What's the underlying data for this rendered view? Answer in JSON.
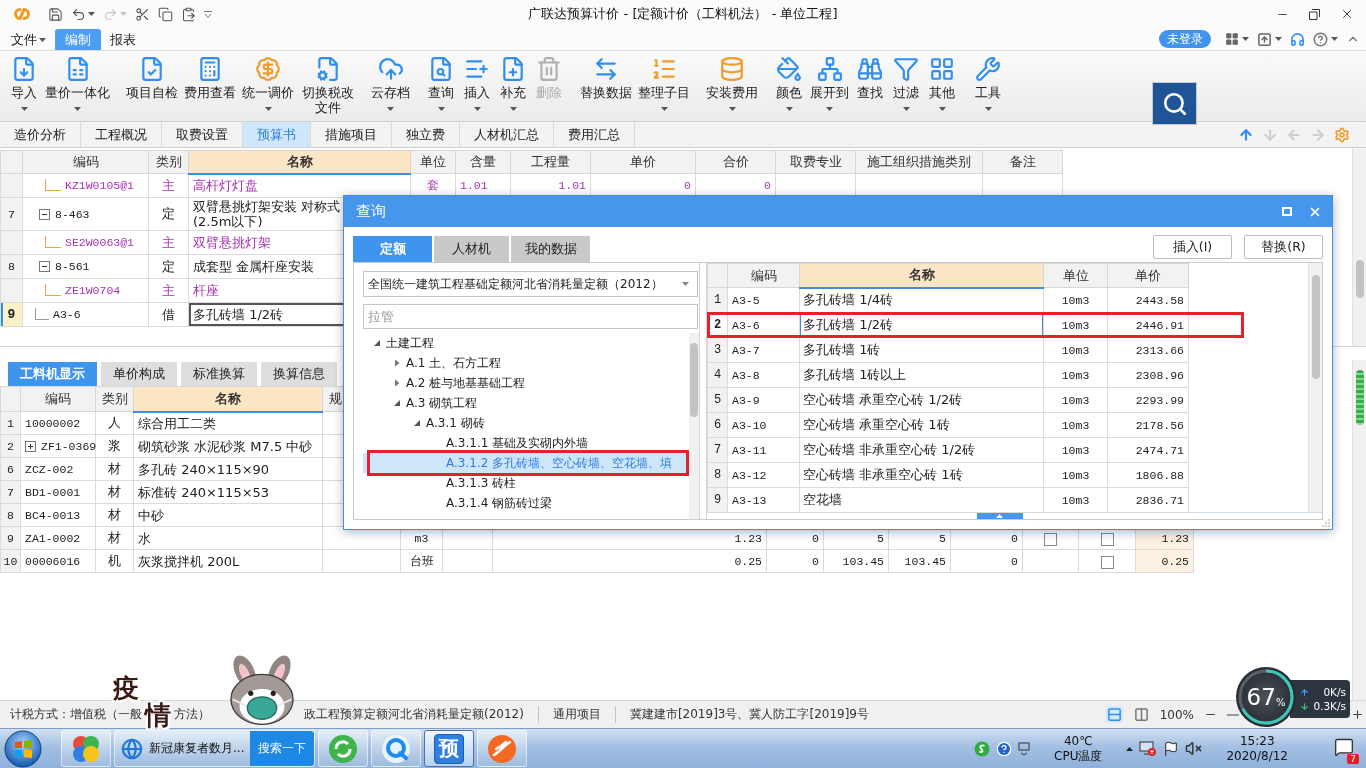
{
  "title_bar": {
    "title": "广联达预算计价 - [定额计价（工料机法） - 单位工程]",
    "quick_access": [
      {
        "disabled": false,
        "dropdown": false
      },
      {
        "disabled": false,
        "dropdown": true
      },
      {
        "disabled": true,
        "dropdown": true
      },
      {
        "disabled": false,
        "dropdown": false
      },
      {
        "disabled": false,
        "dropdown": false
      },
      {
        "disabled": false,
        "dropdown": false
      }
    ]
  },
  "menu": [
    {
      "label": "文件",
      "selected": false,
      "dropdown": true
    },
    {
      "label": "编制",
      "selected": true,
      "dropdown": false
    },
    {
      "label": "报表",
      "selected": false,
      "dropdown": false
    }
  ],
  "account": {
    "login_label": "未登录"
  },
  "ribbon": {
    "groups": [
      {
        "items": [
          {
            "label": "导入",
            "dropdown": true,
            "disabled": false
          },
          {
            "label": "量价一体化",
            "dropdown": true,
            "disabled": false
          }
        ]
      },
      {
        "items": [
          {
            "label": "项目自检",
            "dropdown": false,
            "disabled": false
          },
          {
            "label": "费用查看",
            "dropdown": false,
            "disabled": false
          },
          {
            "label": "统一调价",
            "dropdown": true,
            "disabled": false
          },
          {
            "label": "切换税改文件",
            "dropdown": false,
            "disabled": false
          }
        ]
      },
      {
        "items": [
          {
            "label": "云存档",
            "dropdown": true,
            "disabled": false
          }
        ]
      },
      {
        "items": [
          {
            "label": "查询",
            "dropdown": true,
            "disabled": false
          },
          {
            "label": "插入",
            "dropdown": true,
            "disabled": false
          },
          {
            "label": "补充",
            "dropdown": true,
            "disabled": false
          },
          {
            "label": "删除",
            "dropdown": false,
            "disabled": true
          }
        ]
      },
      {
        "items": [
          {
            "label": "替换数据",
            "dropdown": false,
            "disabled": false
          },
          {
            "label": "整理子目",
            "dropdown": true,
            "disabled": false
          }
        ]
      },
      {
        "items": [
          {
            "label": "安装费用",
            "dropdown": true,
            "disabled": false
          }
        ]
      },
      {
        "items": [
          {
            "label": "颜色",
            "dropdown": true,
            "disabled": false
          },
          {
            "label": "展开到",
            "dropdown": true,
            "disabled": false
          },
          {
            "label": "查找",
            "dropdown": false,
            "disabled": false
          },
          {
            "label": "过滤",
            "dropdown": true,
            "disabled": false
          },
          {
            "label": "其他",
            "dropdown": true,
            "disabled": false
          }
        ]
      },
      {
        "items": [
          {
            "label": "工具",
            "dropdown": true,
            "disabled": false
          }
        ]
      }
    ]
  },
  "view_tabs": [
    {
      "label": "造价分析",
      "selected": false
    },
    {
      "label": "工程概况",
      "selected": false
    },
    {
      "label": "取费设置",
      "selected": false
    },
    {
      "label": "预算书",
      "selected": true
    },
    {
      "label": "措施项目",
      "selected": false
    },
    {
      "label": "独立费",
      "selected": false
    },
    {
      "label": "人材机汇总",
      "selected": false
    },
    {
      "label": "费用汇总",
      "selected": false
    }
  ],
  "nav_arrows": [
    {
      "disabled": false
    },
    {
      "disabled": true
    },
    {
      "disabled": true
    },
    {
      "disabled": true
    }
  ],
  "main_table": {
    "columns": [
      {
        "label": "编码",
        "highlighted": false
      },
      {
        "label": "类别",
        "highlighted": false
      },
      {
        "label": "名称",
        "highlighted": true
      },
      {
        "label": "单位",
        "highlighted": false
      },
      {
        "label": "含量",
        "highlighted": false
      },
      {
        "label": "工程量",
        "highlighted": false
      },
      {
        "label": "单价",
        "highlighted": false
      },
      {
        "label": "合价",
        "highlighted": false
      },
      {
        "label": "取费专业",
        "highlighted": false
      },
      {
        "label": "施工组织措施类别",
        "highlighted": false
      },
      {
        "label": "备注",
        "highlighted": false
      }
    ],
    "rows": [
      {
        "kind": "material",
        "code": "KZ1W0105@1",
        "type": "主",
        "name": "高杆灯灯盘",
        "unit": "套",
        "content": "1.01",
        "quantity": "1.01",
        "unit_price": "0",
        "total": "0",
        "selected": false
      },
      {
        "kind": "quota",
        "number": "7",
        "code": "8-463",
        "type": "定",
        "name": "双臂悬挑灯架安装 对称式\n(2.5m以下)",
        "selected": false,
        "expanded": true,
        "children": [
          {
            "kind": "material",
            "code": "SE2W0063@1",
            "type": "主",
            "name": "双臂悬挑灯架",
            "selected": false
          }
        ]
      },
      {
        "kind": "quota",
        "number": "8",
        "code": "8-561",
        "type": "定",
        "name": "成套型 金属杆座安装",
        "selected": false,
        "expanded": true,
        "children": [
          {
            "kind": "material",
            "code": "ZE1W0704",
            "type": "主",
            "name": "杆座",
            "selected": false
          }
        ]
      },
      {
        "kind": "quota",
        "number": "9",
        "code": "A3-6",
        "type": "借",
        "name": "多孔砖墙 1/2砖",
        "selected": true
      }
    ]
  },
  "detail_tabs": [
    {
      "label": "工料机显示",
      "selected": true
    },
    {
      "label": "单价构成",
      "selected": false
    },
    {
      "label": "标准换算",
      "selected": false
    },
    {
      "label": "换算信息",
      "selected": false
    }
  ],
  "detail_table": {
    "columns": [
      {
        "label": "编码",
        "highlighted": false
      },
      {
        "label": "类别",
        "highlighted": false
      },
      {
        "label": "名称",
        "highlighted": true
      },
      {
        "label": "规",
        "highlighted": false
      }
    ],
    "rows": [
      {
        "number": "1",
        "code": "10000002",
        "type": "人",
        "name": "综合用工二类"
      },
      {
        "number": "2",
        "code": "ZF1-0369",
        "type": "浆",
        "name": "砌筑砂浆 水泥砂浆 M7.5 中砂",
        "expanded": false
      },
      {
        "number": "6",
        "code": "ZCZ-002",
        "type": "材",
        "name": "多孔砖 240×115×90"
      },
      {
        "number": "7",
        "code": "BD1-0001",
        "type": "材",
        "name": "标准砖 240×115×53"
      },
      {
        "number": "8",
        "code": "BC4-0013",
        "type": "材",
        "name": "中砂"
      },
      {
        "number": "9",
        "code": "ZA1-0002",
        "type": "材",
        "name": "水",
        "cells": [
          {
            "kind": "empty"
          },
          {
            "kind": "text",
            "text": "m3"
          },
          {
            "kind": "empty"
          },
          {
            "kind": "number",
            "text": "1.23"
          },
          {
            "kind": "number",
            "text": "0"
          },
          {
            "kind": "number",
            "text": "5"
          },
          {
            "kind": "number",
            "text": "5"
          },
          {
            "kind": "number",
            "text": "0"
          },
          {
            "kind": "checkbox",
            "checked": false
          },
          {
            "kind": "checkbox",
            "checked": false
          },
          {
            "kind": "shaded-number",
            "text": "1.23"
          }
        ]
      },
      {
        "number": "10",
        "code": "00006016",
        "type": "机",
        "name": "灰浆搅拌机 200L",
        "cells": [
          {
            "kind": "empty"
          },
          {
            "kind": "text",
            "text": "台班"
          },
          {
            "kind": "empty"
          },
          {
            "kind": "number",
            "text": "0.25"
          },
          {
            "kind": "number",
            "text": "0"
          },
          {
            "kind": "number",
            "text": "103.45"
          },
          {
            "kind": "number",
            "text": "103.45"
          },
          {
            "kind": "number",
            "text": "0"
          },
          {
            "kind": "empty"
          },
          {
            "kind": "checkbox",
            "checked": false
          },
          {
            "kind": "shaded-number",
            "text": "0.25"
          }
        ]
      }
    ]
  },
  "query_dialog": {
    "title": "查询",
    "tabs": [
      {
        "label": "定额",
        "selected": true
      },
      {
        "label": "人材机",
        "selected": false
      },
      {
        "label": "我的数据",
        "selected": false
      }
    ],
    "buttons": [
      "插入(I)",
      "替换(R)"
    ],
    "library": "全国统一建筑工程基础定额河北省消耗量定额（2012）",
    "search": {
      "placeholder": "拉管"
    },
    "tree": [
      {
        "label": "土建工程",
        "expanded": true,
        "selected": false,
        "marked": false,
        "children": [
          {
            "label": "A.1 土、石方工程",
            "expanded": false,
            "selected": false,
            "marked": false
          },
          {
            "label": "A.2 桩与地基基础工程",
            "expanded": false,
            "selected": false,
            "marked": false
          },
          {
            "label": "A.3 砌筑工程",
            "expanded": true,
            "selected": false,
            "marked": false,
            "children": [
              {
                "label": "A.3.1 砌砖",
                "expanded": true,
                "selected": false,
                "marked": false,
                "children": [
                  {
                    "label": "A.3.1.1 基础及实砌内外墙",
                    "selected": false,
                    "marked": false
                  },
                  {
                    "label": "A.3.1.2 多孔砖墙、空心砖墙、空花墙、填",
                    "selected": true,
                    "marked": true
                  },
                  {
                    "label": "A.3.1.3 砖柱",
                    "selected": false,
                    "marked": false
                  },
                  {
                    "label": "A.3.1.4 钢筋砖过梁",
                    "selected": false,
                    "marked": false
                  }
                ]
              }
            ]
          }
        ]
      }
    ],
    "table": {
      "columns": [
        {
          "label": "编码",
          "highlighted": false
        },
        {
          "label": "名称",
          "highlighted": true
        },
        {
          "label": "单位",
          "highlighted": false
        },
        {
          "label": "单价",
          "highlighted": false
        }
      ],
      "rows": [
        {
          "number": "1",
          "code": "A3-5",
          "name": "多孔砖墙 1/4砖",
          "unit": "10m3",
          "price": "2443.58",
          "selected": false,
          "marked": false
        },
        {
          "number": "2",
          "code": "A3-6",
          "name": "多孔砖墙 1/2砖",
          "unit": "10m3",
          "price": "2446.91",
          "selected": true,
          "marked": true
        },
        {
          "number": "3",
          "code": "A3-7",
          "name": "多孔砖墙 1砖",
          "unit": "10m3",
          "price": "2313.66",
          "selected": false,
          "marked": false
        },
        {
          "number": "4",
          "code": "A3-8",
          "name": "多孔砖墙 1砖以上",
          "unit": "10m3",
          "price": "2308.96",
          "selected": false,
          "marked": false
        },
        {
          "number": "5",
          "code": "A3-9",
          "name": "空心砖墙 承重空心砖 1/2砖",
          "unit": "10m3",
          "price": "2293.99",
          "selected": false,
          "marked": false
        },
        {
          "number": "6",
          "code": "A3-10",
          "name": "空心砖墙 承重空心砖 1砖",
          "unit": "10m3",
          "price": "2178.56",
          "selected": false,
          "marked": false
        },
        {
          "number": "7",
          "code": "A3-11",
          "name": "空心砖墙 非承重空心砖 1/2砖",
          "unit": "10m3",
          "price": "2474.71",
          "selected": false,
          "marked": false
        },
        {
          "number": "8",
          "code": "A3-12",
          "name": "空心砖墙 非承重空心砖 1砖",
          "unit": "10m3",
          "price": "1806.88",
          "selected": false,
          "marked": false
        },
        {
          "number": "9",
          "code": "A3-13",
          "name": "空花墙",
          "unit": "10m3",
          "price": "2836.71",
          "selected": false,
          "marked": false
        }
      ]
    }
  },
  "status_bar": {
    "tax_method": "计税方式：增值税（一般",
    "tax_method_tail": "方法）",
    "items": [
      "政工程预算定额河北省消耗量定额(2012)",
      "通用项目",
      "冀建建市[2019]3号、冀人防工字[2019]9号"
    ],
    "view_modes": [
      {
        "selected": true
      },
      {
        "selected": false
      }
    ],
    "zoom": "100%"
  },
  "sticker": {
    "characters": [
      "疫",
      "情"
    ]
  },
  "cpu_widget": {
    "percent": "67",
    "unit": "%",
    "upload": "0K/s",
    "download": "0.3K/s"
  },
  "taskbar": {
    "buttons": [
      {
        "active": false
      },
      {
        "active": false,
        "title": "新冠康复者数月...",
        "search_label": "搜索一下"
      },
      {
        "active": false
      },
      {
        "active": false
      },
      {
        "active": true,
        "label": "预"
      },
      {
        "active": false
      }
    ],
    "temperature": "40℃",
    "temperature_label": "CPU温度",
    "time": "15:23",
    "date": "2020/8/12",
    "notifications": "7"
  }
}
